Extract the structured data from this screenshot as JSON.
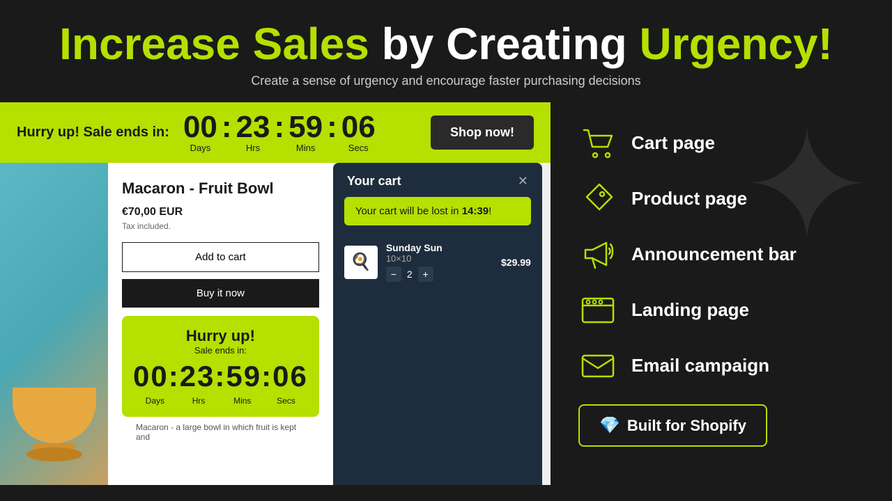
{
  "header": {
    "title_part1": "Increase Sales",
    "title_part2": " by Creating ",
    "title_part3": "Urgency!",
    "subtitle": "Create a sense of urgency and encourage faster purchasing decisions"
  },
  "sale_bar": {
    "label": "Hurry up! Sale ends in:",
    "days": "00",
    "hrs": "23",
    "mins": "59",
    "secs": "06",
    "days_label": "Days",
    "hrs_label": "Hrs",
    "mins_label": "Mins",
    "secs_label": "Secs",
    "shop_now": "Shop now!"
  },
  "product": {
    "title": "Macaron - Fruit Bowl",
    "price": "€70,00 EUR",
    "tax": "Tax included.",
    "add_to_cart": "Add to cart",
    "buy_now": "Buy it now",
    "description": "Macaron - a large bowl in which fruit is kept and"
  },
  "countdown_widget": {
    "hurry": "Hurry up!",
    "sale_ends": "Sale ends in:",
    "time": "00:23:59:06",
    "days": "Days",
    "hrs": "Hrs",
    "mins": "Mins",
    "secs": "Secs"
  },
  "cart": {
    "title": "Your cart",
    "alert": "Your cart will be lost in ",
    "time_bold": "14:39",
    "alert_end": "!",
    "item_name": "Sunday Sun",
    "item_size": "10×10",
    "item_qty": "2",
    "item_price": "$29.99"
  },
  "features": [
    {
      "id": "cart-page",
      "icon": "cart",
      "label": "Cart page"
    },
    {
      "id": "product-page",
      "icon": "tag",
      "label": "Product page"
    },
    {
      "id": "announcement-bar",
      "icon": "megaphone",
      "label": "Announcement bar"
    },
    {
      "id": "landing-page",
      "icon": "browser",
      "label": "Landing page"
    },
    {
      "id": "email-campaign",
      "icon": "email",
      "label": "Email campaign"
    }
  ],
  "shopify_btn": {
    "label": "Built for Shopify",
    "gem": "💎"
  }
}
